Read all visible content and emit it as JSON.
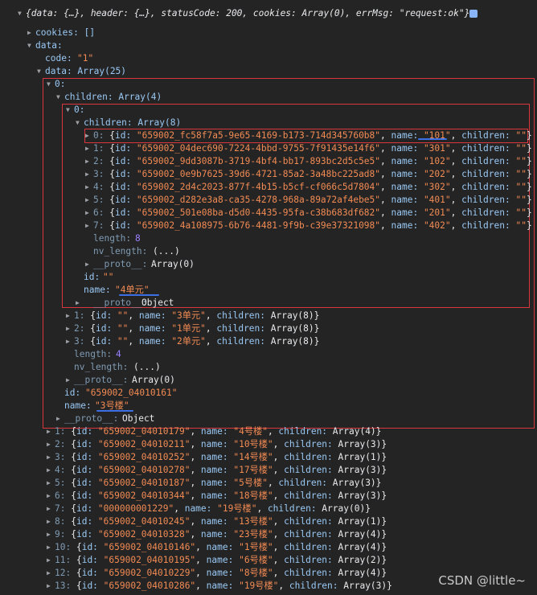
{
  "response": {
    "summary": "{data: {…}, header: {…}, statusCode: 200, cookies: Array(0), errMsg: \"request:ok\"}",
    "cookies": "cookies: []",
    "data_key": "data:",
    "code": "\"1\"",
    "data_array": "data: Array(25)"
  },
  "item0": {
    "label": "0:",
    "children_header": "children: Array(4)",
    "unit0": {
      "label": "0:",
      "children_header": "children: Array(8)",
      "rooms": [
        {
          "idx": "0:",
          "id": "\"659002_fc58f7a5-9e65-4169-b173-714d345760b8\"",
          "name": "\"101\""
        },
        {
          "idx": "1:",
          "id": "\"659002_04dec690-7224-4bbd-9755-7f91435e14f6\"",
          "name": "\"301\""
        },
        {
          "idx": "2:",
          "id": "\"659002_9dd3087b-3719-4bf4-bb17-893bc2d5c5e5\"",
          "name": "\"102\""
        },
        {
          "idx": "3:",
          "id": "\"659002_0e9b7625-39d6-4721-85a2-3a48bc225ad8\"",
          "name": "\"202\""
        },
        {
          "idx": "4:",
          "id": "\"659002_2d4c2023-877f-4b15-b5cf-cf066c5d7804\"",
          "name": "\"302\""
        },
        {
          "idx": "5:",
          "id": "\"659002_d282e3a8-ca35-4278-968a-89a72af4ebe5\"",
          "name": "\"401\""
        },
        {
          "idx": "6:",
          "id": "\"659002_501e08ba-d5d0-4435-95fa-c38b683df682\"",
          "name": "\"201\""
        },
        {
          "idx": "7:",
          "id": "\"659002_4a108975-6b76-4481-9f9b-c39e37321098\"",
          "name": "\"402\""
        }
      ],
      "length": "8",
      "nv_length": "(...)",
      "proto": "Array(0)",
      "id": "\"\"",
      "name": "\"4单元\"",
      "proto_obj": "Object"
    },
    "other_units": [
      {
        "idx": "1:",
        "id": "\"\"",
        "name": "\"3单元\"",
        "children": "Array(8)"
      },
      {
        "idx": "2:",
        "id": "\"\"",
        "name": "\"1单元\"",
        "children": "Array(8)"
      },
      {
        "idx": "3:",
        "id": "\"\"",
        "name": "\"2单元\"",
        "children": "Array(8)"
      }
    ],
    "length": "4",
    "nv_length": "(...)",
    "proto": "Array(0)",
    "id": "\"659002_04010161\"",
    "name": "\"3号楼\"",
    "proto_obj": "Object"
  },
  "buildings": [
    {
      "idx": "1:",
      "id": "\"659002_04010179\"",
      "name": "\"4号楼\"",
      "children": "Array(4)"
    },
    {
      "idx": "2:",
      "id": "\"659002_04010211\"",
      "name": "\"10号楼\"",
      "children": "Array(3)"
    },
    {
      "idx": "3:",
      "id": "\"659002_04010252\"",
      "name": "\"14号楼\"",
      "children": "Array(1)"
    },
    {
      "idx": "4:",
      "id": "\"659002_04010278\"",
      "name": "\"17号楼\"",
      "children": "Array(3)"
    },
    {
      "idx": "5:",
      "id": "\"659002_04010187\"",
      "name": "\"5号楼\"",
      "children": "Array(3)"
    },
    {
      "idx": "6:",
      "id": "\"659002_04010344\"",
      "name": "\"18号楼\"",
      "children": "Array(3)"
    },
    {
      "idx": "7:",
      "id": "\"000000001229\"",
      "name": "\"19号楼\"",
      "children": "Array(0)"
    },
    {
      "idx": "8:",
      "id": "\"659002_04010245\"",
      "name": "\"13号楼\"",
      "children": "Array(1)"
    },
    {
      "idx": "9:",
      "id": "\"659002_04010328\"",
      "name": "\"23号楼\"",
      "children": "Array(4)"
    },
    {
      "idx": "10:",
      "id": "\"659002_04010146\"",
      "name": "\"1号楼\"",
      "children": "Array(4)"
    },
    {
      "idx": "11:",
      "id": "\"659002_04010195\"",
      "name": "\"6号楼\"",
      "children": "Array(2)"
    },
    {
      "idx": "12:",
      "id": "\"659002_04010229\"",
      "name": "\"8号楼\"",
      "children": "Array(4)"
    },
    {
      "idx": "13:",
      "id": "\"659002_04010286\"",
      "name": "\"19号楼\"",
      "children": "Array(3)"
    }
  ],
  "watermark": "CSDN @little~",
  "colors": {
    "background": "#242424",
    "key": "#9ac9f5",
    "string": "#f28b54",
    "number": "#9980ff",
    "highlight_box": "#d9363e",
    "underline": "#3b6fe3"
  }
}
